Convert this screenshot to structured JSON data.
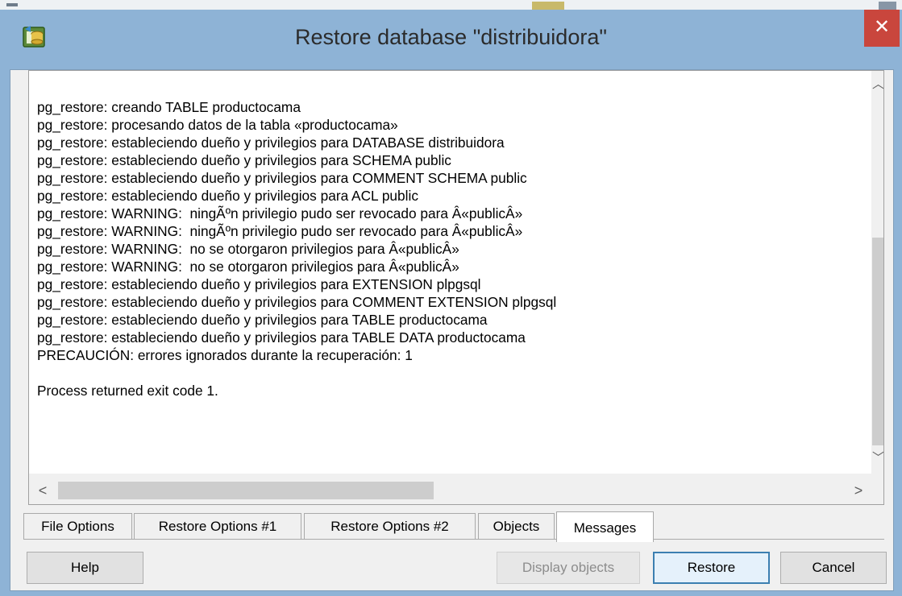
{
  "window": {
    "title": "Restore database \"distribuidora\"",
    "close_glyph": "✕",
    "icon": "database-restore-icon"
  },
  "log": {
    "lines": [
      "pg_restore: creando TABLE productocama",
      "pg_restore: procesando datos de la tabla «productocama»",
      "pg_restore: estableciendo dueño y privilegios para DATABASE distribuidora",
      "pg_restore: estableciendo dueño y privilegios para SCHEMA public",
      "pg_restore: estableciendo dueño y privilegios para COMMENT SCHEMA public",
      "pg_restore: estableciendo dueño y privilegios para ACL public",
      "pg_restore: WARNING:  ningÃºn privilegio pudo ser revocado para Â«publicÂ»",
      "pg_restore: WARNING:  ningÃºn privilegio pudo ser revocado para Â«publicÂ»",
      "pg_restore: WARNING:  no se otorgaron privilegios para Â«publicÂ»",
      "pg_restore: WARNING:  no se otorgaron privilegios para Â«publicÂ»",
      "pg_restore: estableciendo dueño y privilegios para EXTENSION plpgsql",
      "pg_restore: estableciendo dueño y privilegios para COMMENT EXTENSION plpgsql",
      "pg_restore: estableciendo dueño y privilegios para TABLE productocama",
      "pg_restore: estableciendo dueño y privilegios para TABLE DATA productocama",
      "PRECAUCIÓN: errores ignorados durante la recuperación: 1",
      "",
      "Process returned exit code 1."
    ]
  },
  "scrollbars": {
    "up": "︿",
    "down": "﹀",
    "left": "<",
    "right": ">"
  },
  "tabs": [
    {
      "label": "File Options",
      "active": false
    },
    {
      "label": "Restore Options #1",
      "active": false
    },
    {
      "label": "Restore Options #2",
      "active": false
    },
    {
      "label": "Objects",
      "active": false
    },
    {
      "label": "Messages",
      "active": true
    }
  ],
  "buttons": {
    "help": "Help",
    "display_objects": "Display objects",
    "restore": "Restore",
    "cancel": "Cancel"
  },
  "colors": {
    "titlebar": "#8eb3d6",
    "close": "#c9463d",
    "accent": "#3c7fb1"
  }
}
